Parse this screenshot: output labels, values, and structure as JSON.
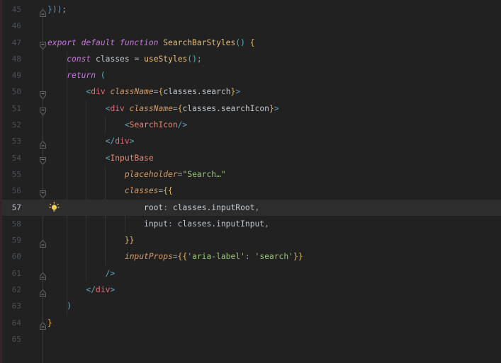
{
  "editor": {
    "language": "javascript-jsx",
    "active_line": 57,
    "colors": {
      "background": "#212121",
      "caret_row": "#2d2d2d",
      "keyword": "#c678dd",
      "function_name": "#e5c07b",
      "attribute": "#d19a66",
      "string": "#98c379",
      "tag": "#e06c75",
      "component": "#e8866e",
      "brace": "#e0b354",
      "paren": "#56b6c2",
      "tag_bracket": "#64a3bd",
      "line_number": "#4c5056",
      "lightbulb": "#f5d04c",
      "left_stripe": "#352428"
    },
    "gutter_icons": {
      "fold_start": "fold-expanded-marker",
      "fold_end": "fold-region-end-marker",
      "intention": "lightbulb-icon"
    },
    "lines": [
      {
        "n": 45,
        "fold": "end",
        "tokens": [
          [
            "}))",
            "blue"
          ],
          [
            ";",
            "op"
          ]
        ]
      },
      {
        "n": 46,
        "fold": null,
        "tokens": []
      },
      {
        "n": 47,
        "fold": "start",
        "tokens": [
          [
            "export default function",
            "kw"
          ],
          [
            " ",
            "pl"
          ],
          [
            "SearchBarStyles",
            "fn"
          ],
          [
            "()",
            "pa"
          ],
          [
            " ",
            "pl"
          ],
          [
            "{",
            "br"
          ]
        ]
      },
      {
        "n": 48,
        "fold": null,
        "tokens": [
          [
            "    ",
            "pl"
          ],
          [
            "const",
            "kw"
          ],
          [
            " ",
            "pl"
          ],
          [
            "classes",
            "id"
          ],
          [
            " ",
            "pl"
          ],
          [
            "=",
            "op"
          ],
          [
            " ",
            "pl"
          ],
          [
            "useStyles",
            "fn"
          ],
          [
            "()",
            "pa"
          ],
          [
            ";",
            "op"
          ]
        ]
      },
      {
        "n": 49,
        "fold": null,
        "tokens": [
          [
            "    ",
            "pl"
          ],
          [
            "return",
            "kw"
          ],
          [
            " ",
            "pl"
          ],
          [
            "(",
            "pa"
          ]
        ]
      },
      {
        "n": 50,
        "fold": "start",
        "tokens": [
          [
            "        ",
            "pl"
          ],
          [
            "<",
            "tb"
          ],
          [
            "div",
            "tag"
          ],
          [
            " ",
            "pl"
          ],
          [
            "className",
            "at"
          ],
          [
            "=",
            "op"
          ],
          [
            "{",
            "br"
          ],
          [
            "classes.search",
            "id"
          ],
          [
            "}",
            "br"
          ],
          [
            ">",
            "tb"
          ]
        ]
      },
      {
        "n": 51,
        "fold": "start",
        "tokens": [
          [
            "            ",
            "pl"
          ],
          [
            "<",
            "tb"
          ],
          [
            "div",
            "tag"
          ],
          [
            " ",
            "pl"
          ],
          [
            "className",
            "at"
          ],
          [
            "=",
            "op"
          ],
          [
            "{",
            "br"
          ],
          [
            "classes.searchIcon",
            "id"
          ],
          [
            "}",
            "br"
          ],
          [
            ">",
            "tb"
          ]
        ]
      },
      {
        "n": 52,
        "fold": null,
        "tokens": [
          [
            "                ",
            "pl"
          ],
          [
            "<",
            "tb"
          ],
          [
            "SearchIcon",
            "cmp"
          ],
          [
            "/>",
            "tb"
          ]
        ]
      },
      {
        "n": 53,
        "fold": "end",
        "tokens": [
          [
            "            ",
            "pl"
          ],
          [
            "</",
            "tb"
          ],
          [
            "div",
            "tag"
          ],
          [
            ">",
            "tb"
          ]
        ]
      },
      {
        "n": 54,
        "fold": "start",
        "tokens": [
          [
            "            ",
            "pl"
          ],
          [
            "<",
            "tb"
          ],
          [
            "InputBase",
            "cmp"
          ]
        ]
      },
      {
        "n": 55,
        "fold": null,
        "tokens": [
          [
            "                ",
            "pl"
          ],
          [
            "placeholder",
            "at"
          ],
          [
            "=",
            "op"
          ],
          [
            "\"Search…\"",
            "str"
          ]
        ]
      },
      {
        "n": 56,
        "fold": "start",
        "tokens": [
          [
            "                ",
            "pl"
          ],
          [
            "classes",
            "at"
          ],
          [
            "=",
            "op"
          ],
          [
            "{{",
            "br"
          ]
        ]
      },
      {
        "n": 57,
        "fold": null,
        "tokens": [
          [
            "                    ",
            "pl"
          ],
          [
            "root",
            "id"
          ],
          [
            ":",
            "op"
          ],
          [
            " ",
            "pl"
          ],
          [
            "classes.inputRoot",
            "id"
          ],
          [
            ",",
            "op"
          ]
        ]
      },
      {
        "n": 58,
        "fold": null,
        "tokens": [
          [
            "                    ",
            "pl"
          ],
          [
            "input",
            "id"
          ],
          [
            ":",
            "op"
          ],
          [
            " ",
            "pl"
          ],
          [
            "classes.inputInput",
            "id"
          ],
          [
            ",",
            "op"
          ]
        ]
      },
      {
        "n": 59,
        "fold": "end",
        "tokens": [
          [
            "                ",
            "pl"
          ],
          [
            "}}",
            "br"
          ]
        ]
      },
      {
        "n": 60,
        "fold": null,
        "tokens": [
          [
            "                ",
            "pl"
          ],
          [
            "inputProps",
            "at"
          ],
          [
            "=",
            "op"
          ],
          [
            "{{",
            "br"
          ],
          [
            "'aria-label'",
            "str"
          ],
          [
            ":",
            "op"
          ],
          [
            " ",
            "pl"
          ],
          [
            "'search'",
            "str"
          ],
          [
            "}}",
            "br"
          ]
        ]
      },
      {
        "n": 61,
        "fold": "end",
        "tokens": [
          [
            "            ",
            "pl"
          ],
          [
            "/>",
            "tb"
          ]
        ]
      },
      {
        "n": 62,
        "fold": "end",
        "tokens": [
          [
            "        ",
            "pl"
          ],
          [
            "</",
            "tb"
          ],
          [
            "div",
            "tag"
          ],
          [
            ">",
            "tb"
          ]
        ]
      },
      {
        "n": 63,
        "fold": null,
        "tokens": [
          [
            "    ",
            "pl"
          ],
          [
            ")",
            "pa"
          ]
        ]
      },
      {
        "n": 64,
        "fold": "end",
        "tokens": [
          [
            "}",
            "br"
          ]
        ]
      },
      {
        "n": 65,
        "fold": null,
        "tokens": []
      }
    ]
  }
}
